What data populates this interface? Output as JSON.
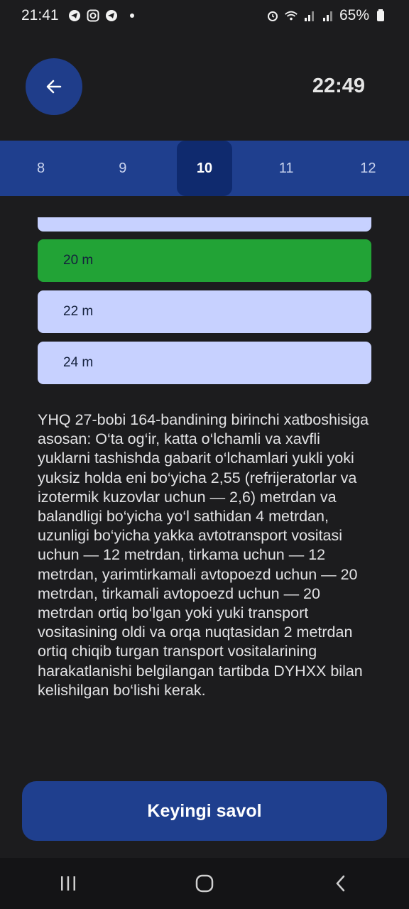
{
  "status_bar": {
    "time": "21:41",
    "battery": "65%",
    "icons": [
      "telegram-icon",
      "instagram-icon",
      "telegram-icon",
      "alarm-icon",
      "wifi-icon",
      "signal-icon",
      "signal-icon",
      "battery-icon"
    ]
  },
  "header": {
    "timer": "22:49",
    "back_icon": "arrow-left-icon"
  },
  "tabs": [
    {
      "label": "8"
    },
    {
      "label": "9"
    },
    {
      "label": "10",
      "active": true
    },
    {
      "label": "11"
    },
    {
      "label": "12"
    }
  ],
  "answers": [
    {
      "label": "20 m",
      "state": "correct"
    },
    {
      "label": "22 m",
      "state": "neutral"
    },
    {
      "label": "24 m",
      "state": "neutral"
    }
  ],
  "explanation": "YHQ 27-bobi 164-bandining birinchi xatboshisiga asosan: O‘ta og‘ir, katta o‘lchamli va xavfli yuklarni tashishda gabarit o‘lchamlari yukli yoki yuksiz holda eni bo‘yicha 2,55 (refrijeratorlar va izotermik kuzovlar uchun — 2,6) metrdan va balandligi bo‘yicha yo‘l sathidan 4 metrdan, uzunligi bo‘yicha yakka avtotransport vositasi uchun — 12 metrdan, tirkama uchun — 12 metrdan, yarimtirkamali avtopoezd uchun — 20 metrdan, tirkamali avtopoezd uchun — 20 metrdan ortiq bo‘lgan yoki yuki transport vositasining oldi va orqa nuqtasidan 2 metrdan ortiq chiqib turgan transport vositalarining harakatlanishi belgilangan tartibda DYHXX bilan kelishilgan bo‘lishi kerak.",
  "next_button": "Keyingi savol",
  "colors": {
    "background": "#1c1c1e",
    "accent": "#1f3f8e",
    "correct": "#22a336",
    "answer": "#c7d1ff"
  }
}
